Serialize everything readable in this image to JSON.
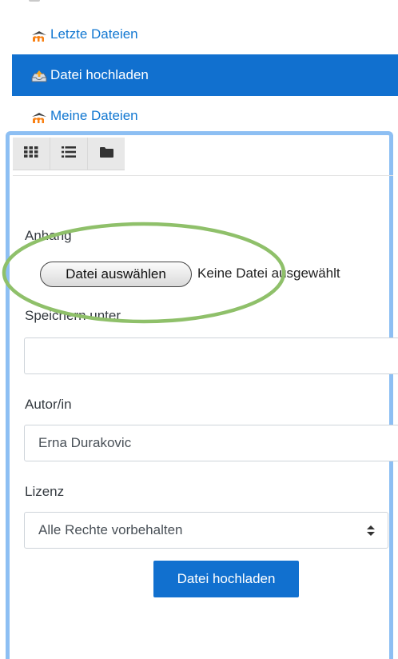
{
  "nav": {
    "recent_label": "Letzte Dateien",
    "upload_label": "Datei hochladen",
    "mine_label": "Meine Dateien"
  },
  "toolbar": {
    "icons": [
      "grid-view-icon",
      "list-view-icon",
      "folder-view-icon"
    ]
  },
  "form": {
    "attachment_label": "Anhang",
    "choose_file_button": "Datei auswählen",
    "no_file_text": "Keine Datei ausgewählt",
    "save_as_label": "Speichern unter",
    "save_as_value": "",
    "author_label": "Autor/in",
    "author_value": "Erna Durakovic",
    "license_label": "Lizenz",
    "license_value": "Alle Rechte vorbehalten",
    "submit_label": "Datei hochladen"
  },
  "colors": {
    "accent": "#1170cf",
    "link": "#1177d1",
    "panel_border": "#8dbff3",
    "highlight_ellipse": "#8fc06a"
  }
}
